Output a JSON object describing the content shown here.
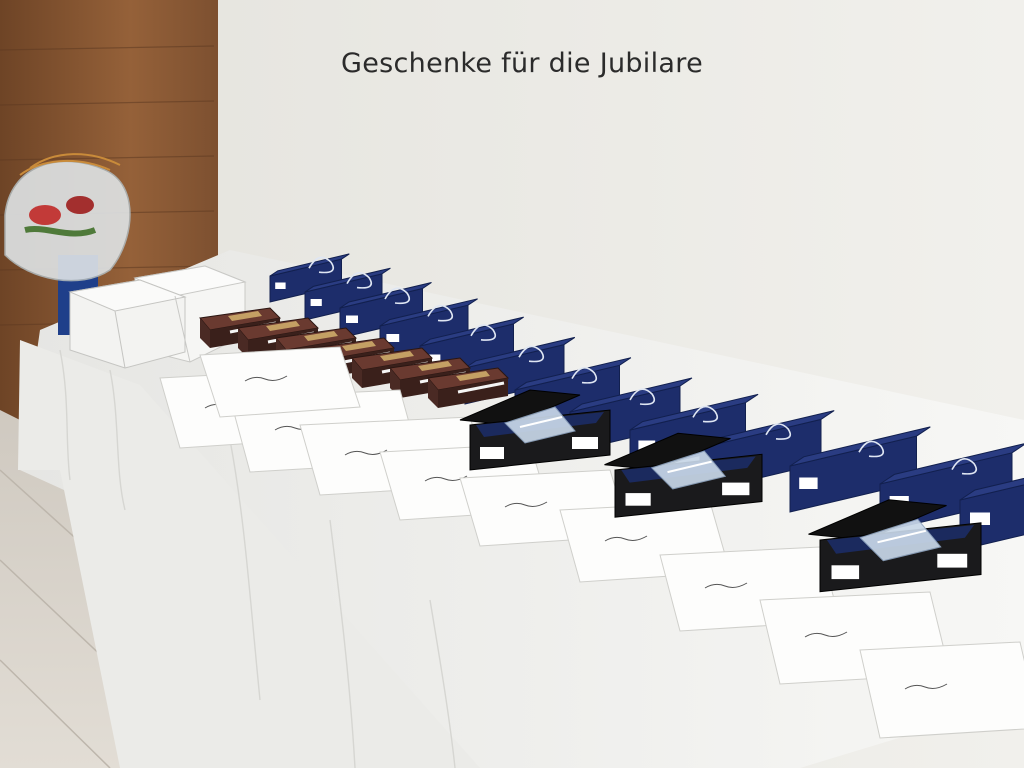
{
  "caption": "Geschenke für die Jubilare",
  "colors": {
    "wall": "#ecebe6",
    "wood_panel": "#8a5a36",
    "floor": "#d7d2ca",
    "tablecloth": "#f3f3f1",
    "navy_box": "#1d2d6b",
    "black_box": "#1a1a1c",
    "brown_box": "#4a2a24",
    "white_box": "#f6f6f4"
  },
  "counts": {
    "navy_boxes": 13,
    "brown_boxes": 7,
    "open_black_boxes": 3,
    "envelopes": 10
  }
}
